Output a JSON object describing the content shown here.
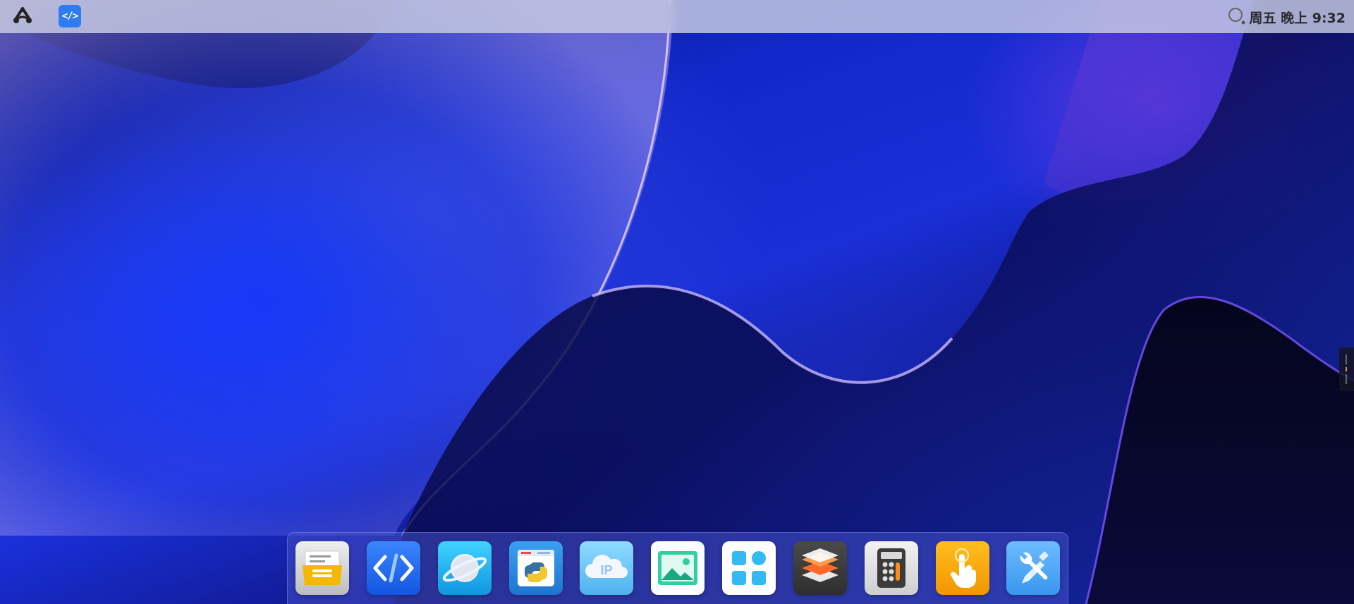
{
  "topbar": {
    "launcher_icon": "app-launcher-icon",
    "active_app_icon": "code-editor-icon",
    "active_app_glyph": "</>",
    "search_icon": "search-icon",
    "clock_text": "周五 晚上 9:32"
  },
  "dock": {
    "items": [
      {
        "icon": "file-manager-icon",
        "color": "#f5b800"
      },
      {
        "icon": "code-editor-icon",
        "color": "#1e6ef0"
      },
      {
        "icon": "browser-planet-icon",
        "color": "#1fb3f0"
      },
      {
        "icon": "python-icon",
        "color": "#2a8ad6"
      },
      {
        "icon": "ip-cloud-icon",
        "color": "#6cc8f5"
      },
      {
        "icon": "image-viewer-icon",
        "color": "#28c39a"
      },
      {
        "icon": "app-store-icon",
        "color": "#2fb4f0"
      },
      {
        "icon": "layers-icon",
        "color": "#3a3a3a"
      },
      {
        "icon": "calculator-icon",
        "color": "#e9e9e9"
      },
      {
        "icon": "touch-pointer-icon",
        "color": "#f5a400"
      },
      {
        "icon": "settings-tools-icon",
        "color": "#4aa8f0"
      }
    ]
  },
  "colors": {
    "topbar_bg": "#c8cde4",
    "dock_bg": "#4650c8",
    "wallpaper_primary": "#1a2fd8"
  }
}
